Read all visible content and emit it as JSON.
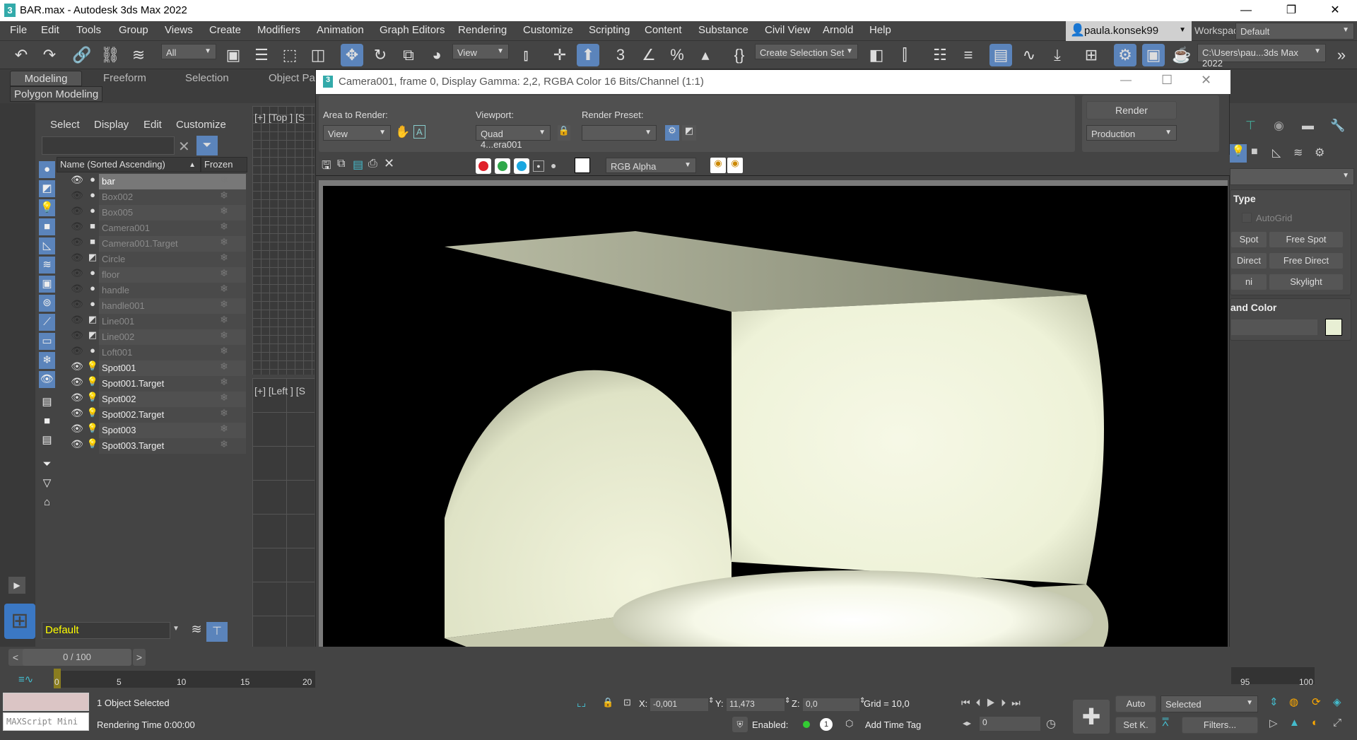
{
  "app": {
    "title": "BAR.max - Autodesk 3ds Max 2022",
    "window_buttons": [
      "—",
      "❐",
      "✕"
    ]
  },
  "menu": {
    "items": [
      "File",
      "Edit",
      "Tools",
      "Group",
      "Views",
      "Create",
      "Modifiers",
      "Animation",
      "Graph Editors",
      "Rendering",
      "Customize",
      "Scripting",
      "Content",
      "Substance",
      "Civil View",
      "Arnold",
      "Help"
    ],
    "user": "paula.konsek99",
    "workspaces_label": "Workspaces:",
    "workspace_value": "Default"
  },
  "toolbar": {
    "selection_filter": "All",
    "reference_coord": "View",
    "selection_set_placeholder": "Create Selection Set",
    "project_path": "C:\\Users\\pau...3ds Max 2022"
  },
  "ribbon": {
    "tabs": [
      "Modeling",
      "Freeform",
      "Selection",
      "Object Pai"
    ],
    "active_tab": "Modeling",
    "subpanel": "Polygon Modeling"
  },
  "scene_explorer": {
    "menu": [
      "Select",
      "Display",
      "Edit",
      "Customize"
    ],
    "search_value": "",
    "columns": {
      "name": "Name (Sorted Ascending)",
      "sort_indicator": "▲",
      "frozen": "Frozen"
    },
    "objects": [
      {
        "name": "bar",
        "type": "geometry",
        "visible": true,
        "selected": true
      },
      {
        "name": "Box002",
        "type": "geometry",
        "visible": false,
        "selected": false
      },
      {
        "name": "Box005",
        "type": "geometry",
        "visible": false,
        "selected": false
      },
      {
        "name": "Camera001",
        "type": "camera",
        "visible": false,
        "selected": false
      },
      {
        "name": "Camera001.Target",
        "type": "camera",
        "visible": false,
        "selected": false
      },
      {
        "name": "Circle",
        "type": "shape",
        "visible": false,
        "selected": false
      },
      {
        "name": "floor",
        "type": "geometry",
        "visible": false,
        "selected": false
      },
      {
        "name": "handle",
        "type": "geometry",
        "visible": false,
        "selected": false
      },
      {
        "name": "handle001",
        "type": "geometry",
        "visible": false,
        "selected": false
      },
      {
        "name": "Line001",
        "type": "shape",
        "visible": false,
        "selected": false
      },
      {
        "name": "Line002",
        "type": "shape",
        "visible": false,
        "selected": false
      },
      {
        "name": "Loft001",
        "type": "geometry",
        "visible": false,
        "selected": false
      },
      {
        "name": "Spot001",
        "type": "light",
        "visible": true,
        "selected": false
      },
      {
        "name": "Spot001.Target",
        "type": "light",
        "visible": true,
        "selected": false
      },
      {
        "name": "Spot002",
        "type": "light",
        "visible": true,
        "selected": false
      },
      {
        "name": "Spot002.Target",
        "type": "light",
        "visible": true,
        "selected": false
      },
      {
        "name": "Spot003",
        "type": "light",
        "visible": true,
        "selected": false
      },
      {
        "name": "Spot003.Target",
        "type": "light",
        "visible": true,
        "selected": false
      }
    ],
    "layer": "Default"
  },
  "viewports": {
    "top_label": "[+] [Top ] [S",
    "left_label": "[+] [Left ] [S"
  },
  "render_window": {
    "title": "Camera001, frame 0, Display Gamma: 2,2, RGBA Color 16 Bits/Channel (1:1)",
    "area_to_render_label": "Area to Render:",
    "area_to_render_value": "View",
    "viewport_label": "Viewport:",
    "viewport_value": "Quad 4...era001",
    "render_preset_label": "Render Preset:",
    "render_preset_value": "",
    "render_button": "Render",
    "render_mode": "Production",
    "channel_display": "RGB Alpha",
    "channels": [
      {
        "name": "red",
        "color": "#e0202a"
      },
      {
        "name": "green",
        "color": "#2fa84a"
      },
      {
        "name": "blue",
        "color": "#1aa7e0"
      }
    ]
  },
  "command_panel": {
    "rollout_type_title": "Type",
    "autogrid_label": "AutoGrid",
    "light_buttons": [
      "Spot",
      "Free Spot",
      "Direct",
      "Free Direct",
      "ni",
      "Skylight"
    ],
    "name_color_title": "and Color",
    "object_color": "#e8efd4"
  },
  "status": {
    "selection": "1 Object Selected",
    "render_time": "Rendering Time  0:00:00",
    "maxscript_placeholder": "MAXScript Mini",
    "x_label": "X:",
    "x": "-0,001",
    "y_label": "Y:",
    "y": "11,473",
    "z_label": "Z:",
    "z": "0,0",
    "grid": "Grid = 10,0",
    "enabled_label": "Enabled:",
    "enabled_count": "1",
    "add_time_tag": "Add Time Tag"
  },
  "timeline": {
    "frame_display": "0 / 100",
    "prev": "<",
    "next": ">",
    "ticks": [
      "0",
      "5",
      "10",
      "15",
      "20"
    ],
    "ticks_right": [
      "95",
      "100"
    ],
    "current_frame": "0",
    "auto_key": "Auto",
    "set_key": "Set K.",
    "key_filter": "Selected",
    "filters": "Filters..."
  }
}
